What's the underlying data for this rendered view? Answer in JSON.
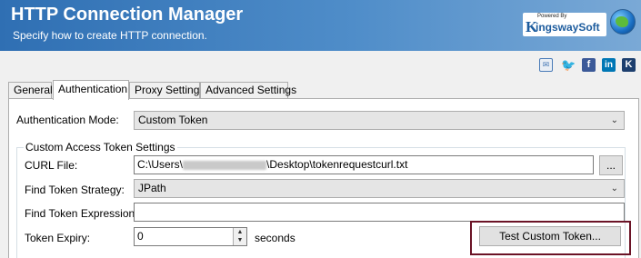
{
  "header": {
    "title": "HTTP Connection Manager",
    "subtitle": "Specify how to create HTTP connection.",
    "logo_powered": "Powered By",
    "logo_k": "K",
    "logo_name": "ingswaySoft"
  },
  "social": {
    "mail": "✉",
    "twitter": "🐦",
    "facebook": "f",
    "linkedin": "in",
    "kingsway": "K"
  },
  "tabs": [
    {
      "label": "General"
    },
    {
      "label": "Authentication"
    },
    {
      "label": "Proxy Settings"
    },
    {
      "label": "Advanced Settings"
    }
  ],
  "form": {
    "auth_mode_label": "Authentication Mode:",
    "auth_mode_value": "Custom Token",
    "group_title": "Custom Access Token Settings",
    "curl_label": "CURL File:",
    "curl_prefix": "C:\\Users\\",
    "curl_suffix": "\\Desktop\\tokenrequestcurl.txt",
    "browse_label": "...",
    "strategy_label": "Find Token Strategy:",
    "strategy_value": "JPath",
    "expression_label": "Find Token Expression:",
    "expression_value": "",
    "expiry_label": "Token Expiry:",
    "expiry_value": "0",
    "expiry_unit": "seconds",
    "test_button": "Test Custom Token..."
  }
}
